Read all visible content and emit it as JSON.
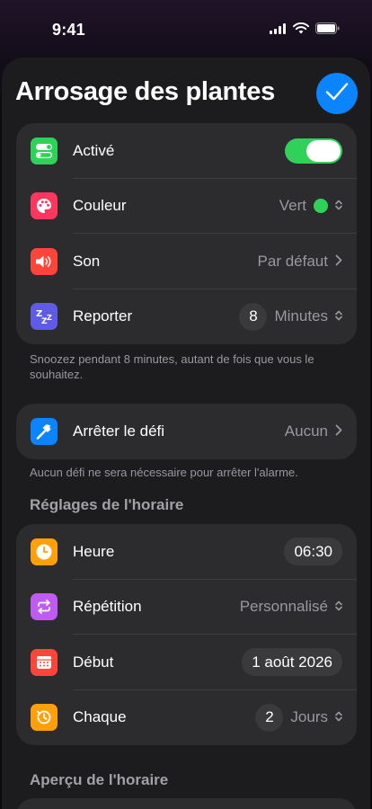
{
  "status_bar": {
    "time": "9:41"
  },
  "header": {
    "title": "Arrosage des plantes"
  },
  "main_group": {
    "active": {
      "label": "Activé",
      "on": true
    },
    "color": {
      "label": "Couleur",
      "value": "Vert",
      "dot_color": "#30d158"
    },
    "sound": {
      "label": "Son",
      "value": "Par défaut"
    },
    "snooze": {
      "label": "Reporter",
      "number": "8",
      "unit": "Minutes"
    }
  },
  "snooze_footnote": "Snoozez pendant 8 minutes, autant de fois que vous le souhaitez.",
  "challenge": {
    "label": "Arrêter le défi",
    "value": "Aucun"
  },
  "challenge_footnote": "Aucun défi ne sera nécessaire pour arrêter l'alarme.",
  "schedule_settings": {
    "header": "Réglages de l'horaire",
    "time": {
      "label": "Heure",
      "value": "06:30"
    },
    "repeat": {
      "label": "Répétition",
      "value": "Personnalisé"
    },
    "start": {
      "label": "Début",
      "value": "1 août 2026"
    },
    "every": {
      "label": "Chaque",
      "number": "2",
      "unit": "Jours"
    }
  },
  "schedule_preview": {
    "header": "Aperçu de l'horaire"
  },
  "colors": {
    "accent": "#0a84ff",
    "toggle_on": "#30d158",
    "icon_active": "#30d158",
    "icon_color": "#ff375f",
    "icon_sound": "#ff453a",
    "icon_snooze": "#5e5ce6",
    "icon_challenge": "#0a84ff",
    "icon_time": "#ff9f0a",
    "icon_repeat": "#bf5af2",
    "icon_start": "#ff453a",
    "icon_every": "#ff9f0a"
  }
}
